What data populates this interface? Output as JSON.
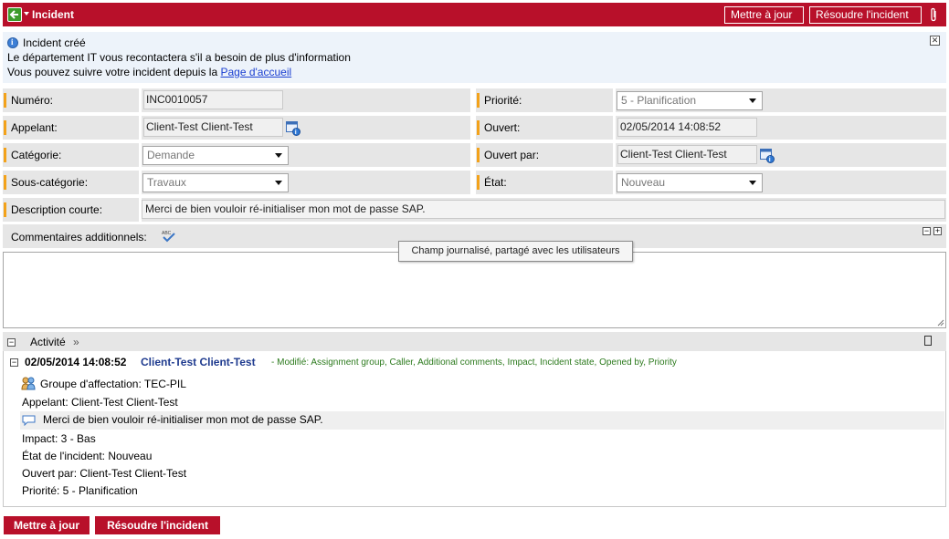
{
  "header": {
    "title": "Incident",
    "update_label": "Mettre à jour",
    "resolve_label": "Résoudre l'incident"
  },
  "info": {
    "line1": "Incident créé",
    "line2": "Le département IT vous recontactera s'il a besoin de plus d'information",
    "line3_prefix": "Vous pouvez suivre votre incident depuis la ",
    "link": "Page d'accueil"
  },
  "form": {
    "numero_label": "Numéro:",
    "numero_value": "INC0010057",
    "appelant_label": "Appelant:",
    "appelant_value": "Client-Test Client-Test",
    "categorie_label": "Catégorie:",
    "categorie_value": "Demande",
    "souscategorie_label": "Sous-catégorie:",
    "souscategorie_value": "Travaux",
    "description_label": "Description courte:",
    "description_value": "Merci de bien vouloir ré-initialiser mon mot de passe SAP.",
    "priorite_label": "Priorité:",
    "priorite_value": "5 - Planification",
    "ouvert_label": "Ouvert:",
    "ouvert_value": "02/05/2014 14:08:52",
    "ouvertpar_label": "Ouvert par:",
    "ouvertpar_value": "Client-Test Client-Test",
    "etat_label": "État:",
    "etat_value": "Nouveau"
  },
  "comments": {
    "label": "Commentaires additionnels:",
    "tooltip": "Champ journalisé, partagé avec les utilisateurs",
    "value": ""
  },
  "activity": {
    "title": "Activité",
    "chevrons": "»",
    "entry_date": "02/05/2014 14:08:52",
    "entry_user": "Client-Test Client-Test",
    "entry_modified": "- Modifié:  Assignment group, Caller, Additional comments, Impact, Incident state, Opened by, Priority",
    "lines": [
      "Groupe d'affectation: TEC-PIL",
      "Appelant: Client-Test Client-Test",
      "Merci de bien vouloir ré-initialiser mon mot de passe SAP.",
      "Impact: 3 - Bas",
      "État de l'incident: Nouveau",
      "Ouvert par: Client-Test Client-Test",
      "Priorité: 5 - Planification"
    ]
  },
  "footer": {
    "update_label": "Mettre à jour",
    "resolve_label": "Résoudre l'incident"
  },
  "colors": {
    "brand": "#b8102a",
    "mandatory": "#f3a21a",
    "link": "#1a3fd1",
    "activity_user": "#1f3b8f",
    "activity_modified": "#2c7a1d"
  },
  "icons": {
    "back": "back-arrow-icon",
    "attachment": "paperclip-icon",
    "info": "info-icon",
    "close": "close-icon",
    "reference": "reference-lookup-icon",
    "spellcheck": "spellcheck-icon",
    "group": "group-icon",
    "comment": "comment-bubble-icon"
  }
}
